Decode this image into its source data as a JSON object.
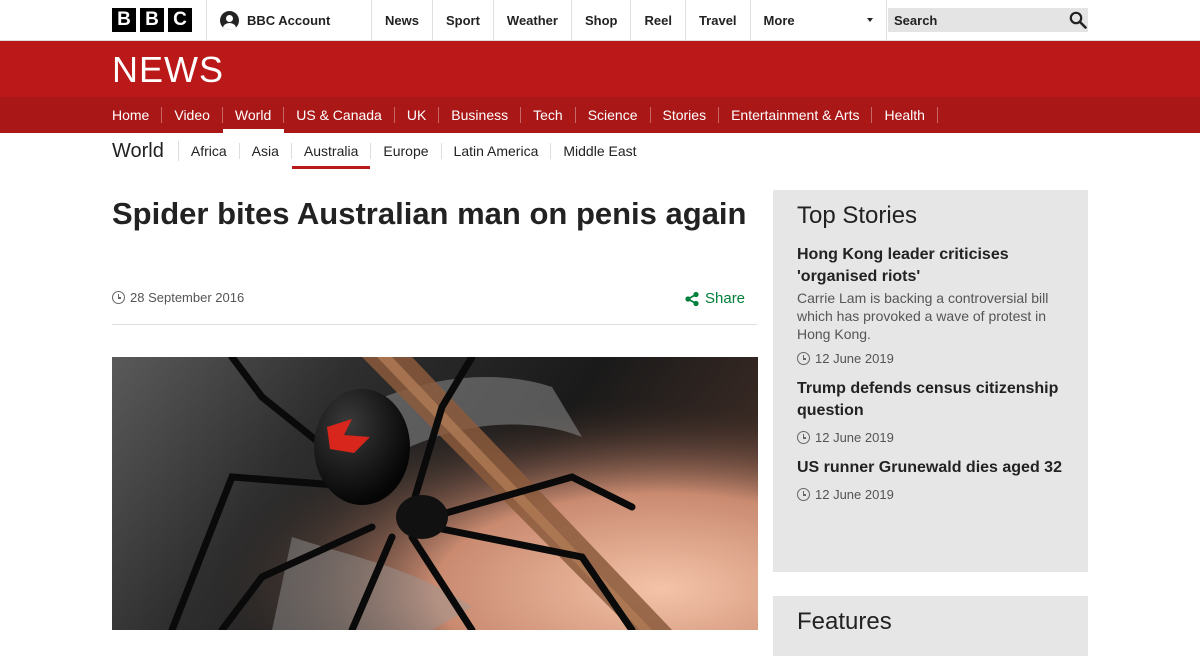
{
  "brand": {
    "letters": [
      "B",
      "B",
      "C"
    ],
    "news_wordmark": "NEWS",
    "banner_color": "#bb1919",
    "nav_color": "#a91717"
  },
  "account": {
    "label": "BBC Account"
  },
  "topnav": [
    "News",
    "Sport",
    "Weather",
    "Shop",
    "Reel",
    "Travel",
    "More"
  ],
  "search": {
    "placeholder": "Search"
  },
  "sectionnav": {
    "items": [
      "Home",
      "Video",
      "World",
      "US & Canada",
      "UK",
      "Business",
      "Tech",
      "Science",
      "Stories",
      "Entertainment & Arts",
      "Health"
    ],
    "active": "World"
  },
  "subnav": {
    "title": "World",
    "items": [
      "Africa",
      "Asia",
      "Australia",
      "Europe",
      "Latin America",
      "Middle East"
    ],
    "active": "Australia",
    "accent": "#bb1919"
  },
  "article": {
    "headline": "Spider bites Australian man on penis again",
    "date": "28 September 2016",
    "share_label": "Share",
    "share_color": "#007f3a"
  },
  "sidebar": {
    "top_stories_title": "Top Stories",
    "stories": [
      {
        "title": "Hong Kong leader criticises 'organised riots'",
        "summary": "Carrie Lam is backing a controversial bill which has provoked a wave of protest in Hong Kong.",
        "date": "12 June 2019"
      },
      {
        "title": "Trump defends census citizenship question",
        "summary": "",
        "date": "12 June 2019"
      },
      {
        "title": "US runner Grunewald dies aged 32",
        "summary": "",
        "date": "12 June 2019"
      }
    ],
    "features_title": "Features"
  }
}
